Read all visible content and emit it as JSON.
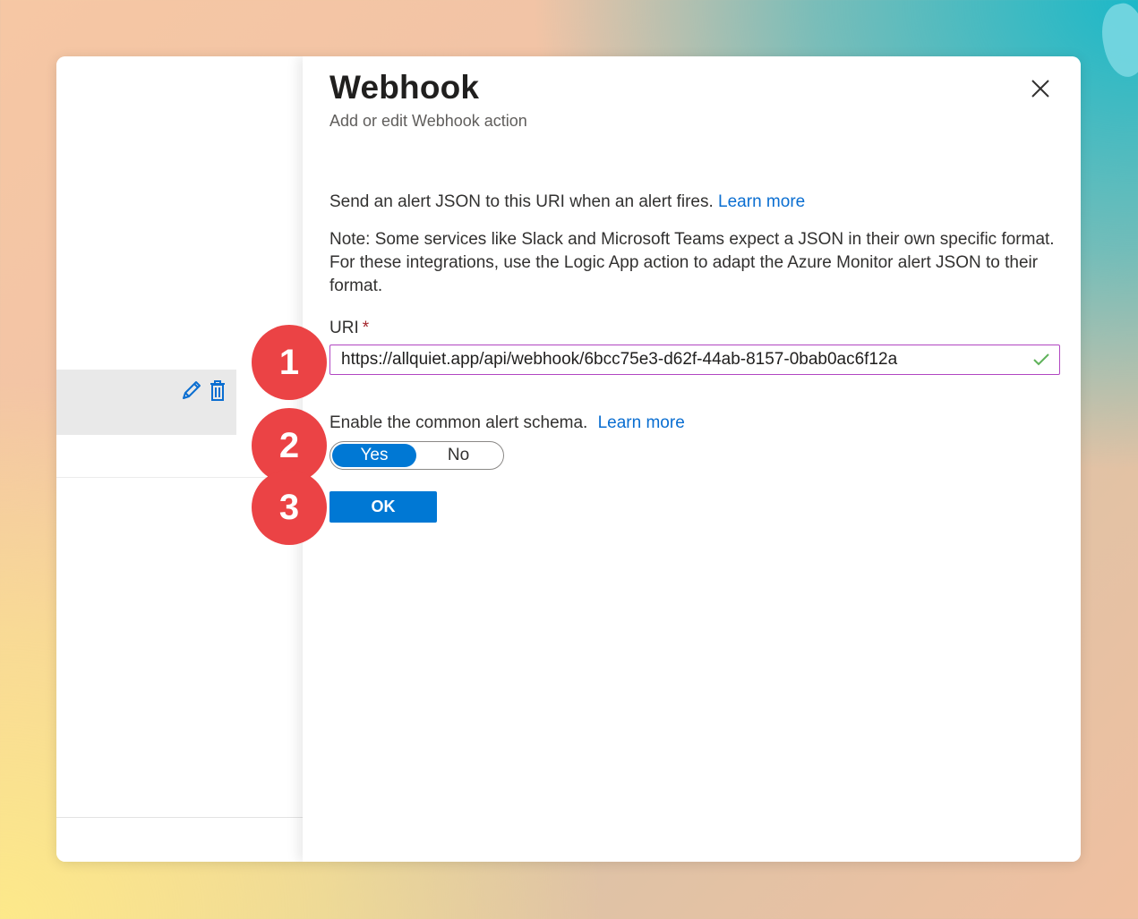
{
  "panel": {
    "title": "Webhook",
    "subtitle": "Add or edit Webhook action",
    "description": "Send an alert JSON to this URI when an alert fires.",
    "description_link": "Learn more",
    "note": "Note: Some services like Slack and Microsoft Teams expect a JSON in their own specific format. For these integrations, use the Logic App action to adapt the Azure Monitor alert JSON to their format.",
    "uri_label": "URI",
    "required_marker": "*",
    "uri_value": "https://allquiet.app/api/webhook/6bcc75e3-d62f-44ab-8157-0bab0ac6f12a",
    "schema_label": "Enable the common alert schema.",
    "schema_link": "Learn more",
    "toggle": {
      "yes": "Yes",
      "no": "No",
      "selected": "Yes"
    },
    "ok_label": "OK"
  },
  "badges": [
    "1",
    "2",
    "3"
  ],
  "colors": {
    "accent": "#0078d4",
    "link": "#0a6ed1",
    "badge": "#eb4345",
    "valid_check": "#5fb25a",
    "focus_border": "#b146c2"
  },
  "icons": [
    "close-icon",
    "pencil-icon",
    "trash-icon",
    "checkmark-icon"
  ]
}
